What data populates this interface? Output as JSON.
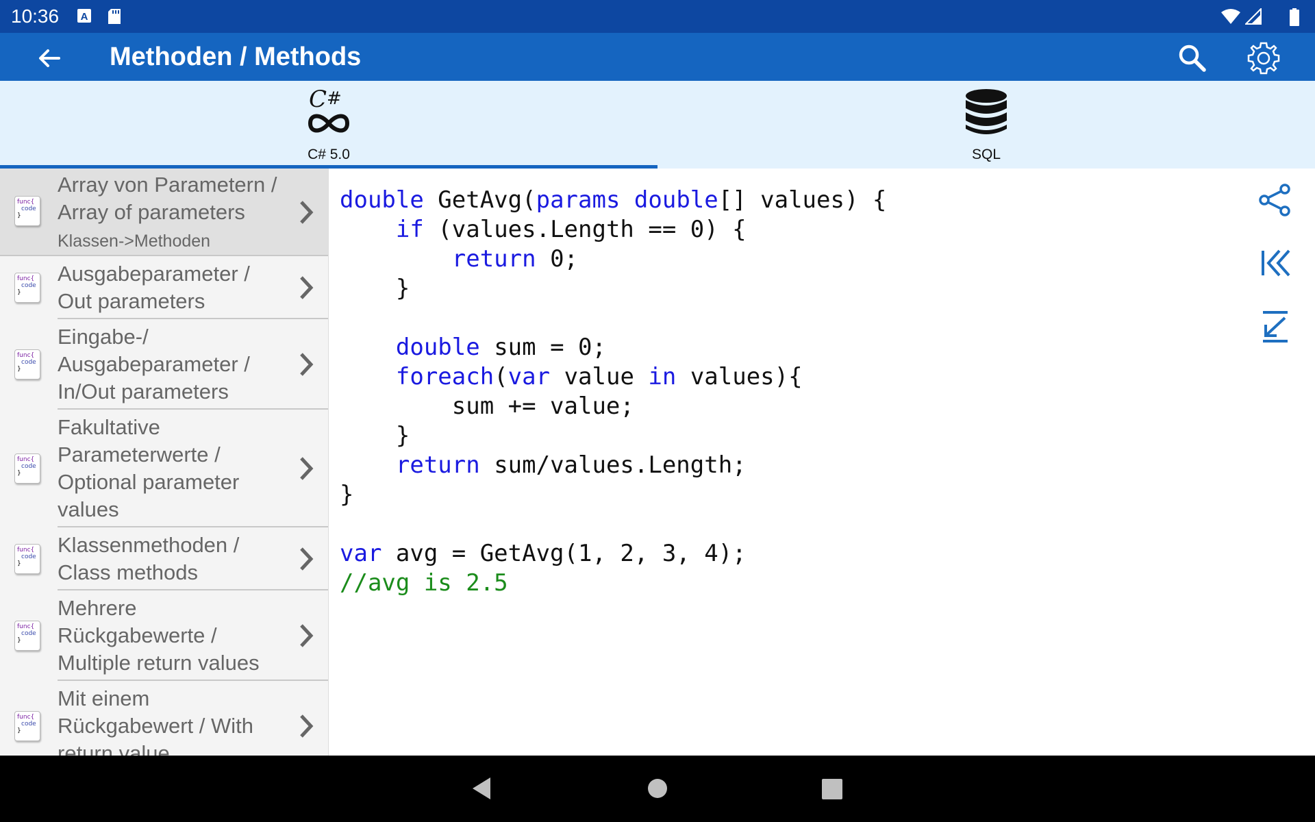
{
  "status_bar": {
    "time": "10:36"
  },
  "app_bar": {
    "title": "Methoden / Methods"
  },
  "tabs": [
    {
      "label": "C# 5.0",
      "icon": "csharp-infinity-icon",
      "selected": true
    },
    {
      "label": "SQL",
      "icon": "database-icon",
      "selected": false
    }
  ],
  "list": {
    "items": [
      {
        "label": "Array von Parametern /\nArray of parameters",
        "subtitle": "Klassen->Methoden",
        "selected": true
      },
      {
        "label": "Ausgabeparameter /\nOut parameters"
      },
      {
        "label": "Eingabe-/\nAusgabeparameter /\nIn/Out parameters"
      },
      {
        "label": "Fakultative\nParameterwerte /\nOptional parameter\nvalues"
      },
      {
        "label": "Klassenmethoden /\nClass methods"
      },
      {
        "label": "Mehrere\nRückgabewerte /\nMultiple return values"
      },
      {
        "label": "Mit einem\nRückgabewert / With\nreturn value"
      }
    ],
    "icon_text": {
      "line1": "func{",
      "line2": "code",
      "line3": "}"
    }
  },
  "code": {
    "lines": [
      [
        [
          "kw",
          "double"
        ],
        [
          "t",
          " GetAvg("
        ],
        [
          "kw",
          "params"
        ],
        [
          "t",
          " "
        ],
        [
          "kw",
          "double"
        ],
        [
          "t",
          "[] values) {"
        ]
      ],
      [
        [
          "t",
          "    "
        ],
        [
          "kw",
          "if"
        ],
        [
          "t",
          " (values.Length == 0) {"
        ]
      ],
      [
        [
          "t",
          "        "
        ],
        [
          "kw",
          "return"
        ],
        [
          "t",
          " 0;"
        ]
      ],
      [
        [
          "t",
          "    }"
        ]
      ],
      [
        [
          "t",
          ""
        ]
      ],
      [
        [
          "t",
          "    "
        ],
        [
          "kw",
          "double"
        ],
        [
          "t",
          " sum = 0;"
        ]
      ],
      [
        [
          "t",
          "    "
        ],
        [
          "kw",
          "foreach"
        ],
        [
          "t",
          "("
        ],
        [
          "kw",
          "var"
        ],
        [
          "t",
          " value "
        ],
        [
          "kw",
          "in"
        ],
        [
          "t",
          " values){"
        ]
      ],
      [
        [
          "t",
          "        sum += value;"
        ]
      ],
      [
        [
          "t",
          "    }"
        ]
      ],
      [
        [
          "t",
          "    "
        ],
        [
          "kw",
          "return"
        ],
        [
          "t",
          " sum/values.Length;"
        ]
      ],
      [
        [
          "t",
          "}"
        ]
      ],
      [
        [
          "t",
          ""
        ]
      ],
      [
        [
          "kw",
          "var"
        ],
        [
          "t",
          " avg = GetAvg(1, 2, 3, 4);"
        ]
      ],
      [
        [
          "cm",
          "//avg is 2.5"
        ]
      ]
    ]
  },
  "actions": [
    "share-icon",
    "first-page-icon",
    "scroll-to-bottom-icon"
  ],
  "colors": {
    "status_bar": "#0d47a1",
    "app_bar": "#1565c0",
    "tab_bar": "#e3f2fd",
    "keyword": "#1a1ae0",
    "comment": "#1b8c1b"
  }
}
